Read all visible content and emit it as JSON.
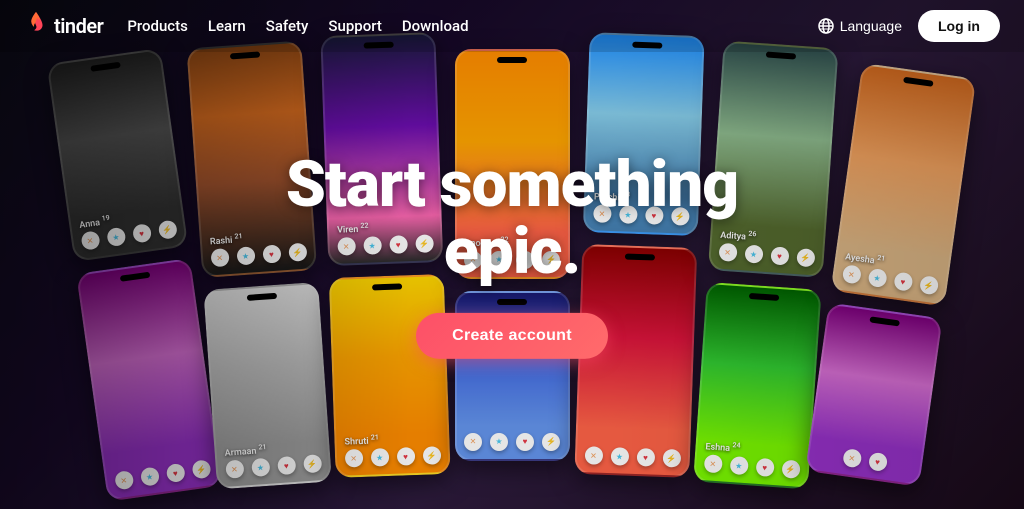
{
  "brand": {
    "name": "tinder",
    "logo_aria": "Tinder logo"
  },
  "navbar": {
    "links": [
      {
        "id": "products",
        "label": "Products"
      },
      {
        "id": "learn",
        "label": "Learn"
      },
      {
        "id": "safety",
        "label": "Safety"
      },
      {
        "id": "support",
        "label": "Support"
      },
      {
        "id": "download",
        "label": "Download"
      }
    ],
    "language_label": "Language",
    "login_label": "Log in"
  },
  "hero": {
    "title": "Start something epic.",
    "cta_label": "Create account"
  },
  "phones": [
    {
      "id": "rashi",
      "name": "Rashi",
      "age": "21",
      "color_class": "pc-rashi",
      "size": "normal"
    },
    {
      "id": "viren",
      "name": "Viren",
      "age": "22",
      "color_class": "pc-viren",
      "size": "tall"
    },
    {
      "id": "apoorva",
      "name": "Apoorva",
      "age": "32",
      "color_class": "pc-apoorva",
      "size": "normal"
    },
    {
      "id": "prachi",
      "name": "Prachi",
      "age": "23",
      "color_class": "pc-prachi",
      "size": "normal"
    },
    {
      "id": "aditya",
      "name": "Aditya",
      "age": "26",
      "color_class": "pc-aditya",
      "size": "normal"
    },
    {
      "id": "ayesha",
      "name": "Ayesha",
      "age": "21",
      "color_class": "pc-ayesha",
      "size": "tall"
    },
    {
      "id": "anna",
      "name": "Anna",
      "age": "19",
      "color_class": "pc-anna",
      "size": "normal"
    },
    {
      "id": "armaan",
      "name": "Armaan",
      "age": "21",
      "color_class": "pc-armaan",
      "size": "normal"
    },
    {
      "id": "shruti",
      "name": "Shruti",
      "age": "21",
      "color_class": "pc-shruti",
      "size": "tall"
    },
    {
      "id": "eshna",
      "name": "Eshna",
      "age": "24",
      "color_class": "pc-eshna",
      "size": "normal"
    }
  ],
  "colors": {
    "accent": "#fd5068",
    "nav_bg": "rgba(0,0,0,0.15)",
    "background": "#0d0d1a"
  }
}
